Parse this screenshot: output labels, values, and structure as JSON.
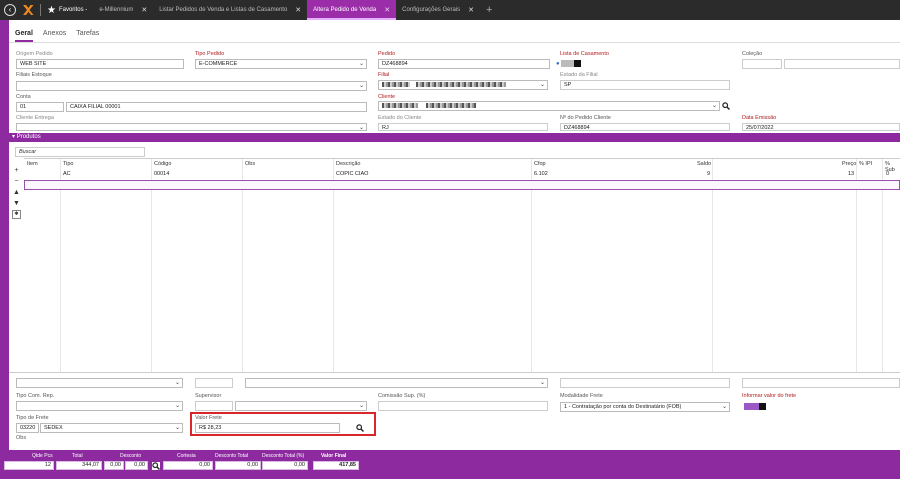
{
  "topbar": {
    "back_icon": "back-arrow-icon",
    "favorites_label": "Favoritos -",
    "tabs": [
      {
        "label": "e-Millennium",
        "active": false
      },
      {
        "label": "Listar Pedidos de Venda e Listas de Casamento",
        "active": false
      },
      {
        "label": "Altera Pedido de Venda",
        "active": true
      },
      {
        "label": "Configurações Gerais",
        "active": false
      }
    ],
    "tab_close_symbol": "✕",
    "add_tab_symbol": "+"
  },
  "inner_tabs": [
    "Geral",
    "Anexos",
    "Tarefas"
  ],
  "form": {
    "origem_pedido_label": "Origem Pedido",
    "origem_pedido_value": "WEB SITE",
    "tipo_pedido_label": "Tipo Pedido",
    "tipo_pedido_value": "E-COMMERCE",
    "pedido_label": "Pedido",
    "pedido_value": "DZ468894",
    "lista_casamento_label": "Lista de Casamento",
    "colecao_label": "Coleção",
    "filiais_estoque_label": "Filiais Estoque",
    "filial_label": "Filial",
    "estado_filial_label": "Estado da Filial",
    "estado_filial_value": "SP",
    "conta_label": "Conta",
    "conta_code": "01",
    "conta_name": "CAIXA FILIAL 00001",
    "cliente_label": "Cliente",
    "cliente_entrega_label": "Cliente Entrega",
    "estado_cliente_label": "Estado do Cliente",
    "estado_cliente_value": "RJ",
    "pedido_cliente_label": "Nº do Pedido Cliente",
    "pedido_cliente_value": "DZ468894",
    "data_emissao_label": "Data Emissão",
    "data_emissao_value": "25/07/2022"
  },
  "produtos": {
    "header": "Produtos",
    "search_placeholder": "Buscar",
    "columns": [
      "Item",
      "Tipo",
      "Código",
      "Obs",
      "Descrição",
      "Cfop",
      "Saldo",
      "Preço",
      "% IPI",
      "% Sub"
    ],
    "rows": [
      {
        "tipo": "AC",
        "codigo": "00014",
        "obs": "",
        "descricao": "COPIC CIAO",
        "cfop": "6.102",
        "saldo": "9",
        "preco": "13",
        "ipi": "0"
      }
    ],
    "tools": [
      "+",
      "−",
      "▲",
      "▼",
      "✱"
    ]
  },
  "bottom": {
    "tipo_com_rep_label": "Tipo Com. Rep.",
    "supervisor_label": "Supervisor",
    "comissao_sup_label": "Comissão Sup. (%)",
    "modalidade_frete_label": "Modalidade Frete",
    "modalidade_frete_value": "1 - Contratação por conta do Destinatário (FOB)",
    "informar_valor_frete_label": "Informar valor do frete",
    "tipo_frete_label": "Tipo de Frete",
    "tipo_frete_code": "03220",
    "tipo_frete_name": "SEDEX",
    "valor_frete_label": "Valor Frete",
    "valor_frete_value": "R$ 28,23",
    "obs_label": "Obs"
  },
  "footer": {
    "qtde_pcs_label": "Qtde Pcs",
    "qtde_pcs_value": "12",
    "total_label": "Total",
    "total_value": "344,07",
    "desconto_label": "Desconto",
    "desconto_value1": "0,00",
    "desconto_value2": "0,00",
    "cortesia_label": "Cortesia",
    "cortesia_value": "0,00",
    "desconto_total_label": "Desconto Total",
    "desconto_total_value": "0,00",
    "desconto_total_pct_label": "Desconto Total (%)",
    "desconto_total_pct_value": "0,00",
    "valor_final_label": "Valor Final",
    "valor_final_value": "417,85"
  },
  "colors": {
    "accent": "#8e2aa0",
    "highlight": "#d9262c",
    "required_label": "#b01c1c"
  }
}
